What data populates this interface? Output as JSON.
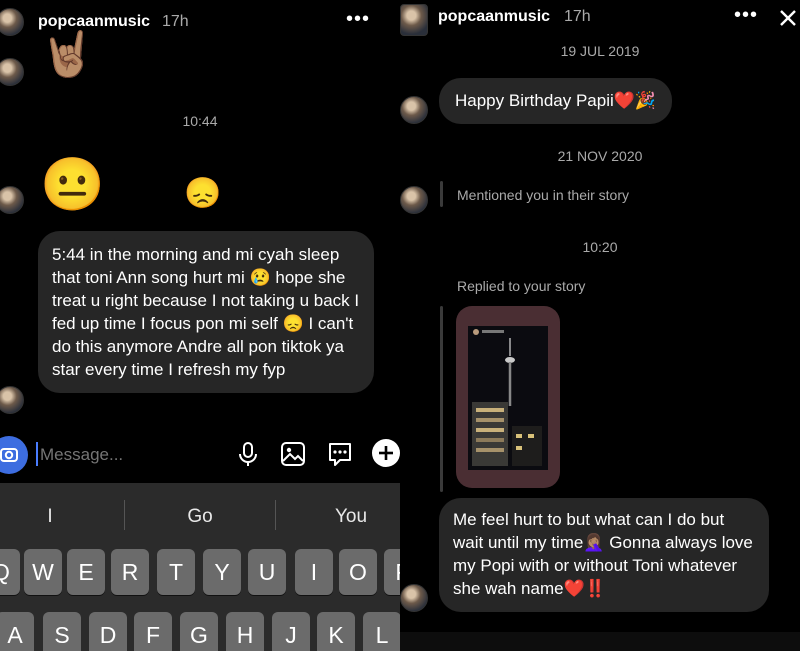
{
  "left": {
    "header": {
      "username": "popcaanmusic",
      "time": "17h"
    },
    "timestamp": "10:44",
    "message": "5:44 in the morning and mi cyah sleep that toni Ann song hurt mi 😢  hope she treat u right because I not taking u back I fed up time I focus pon mi self 😞  I can't do this anymore Andre  all pon tiktok ya star every time I refresh my fyp",
    "composer": {
      "placeholder": "Message..."
    },
    "keyboard": {
      "suggestions": [
        "I",
        "Go",
        "You"
      ],
      "row1": [
        "Q",
        "W",
        "E",
        "R",
        "T",
        "Y",
        "U",
        "I",
        "O",
        "P"
      ],
      "row2": [
        "A",
        "S",
        "D",
        "F",
        "G",
        "H",
        "J",
        "K",
        "L"
      ]
    },
    "icons": [
      "camera-icon",
      "microphone-icon",
      "gallery-icon",
      "sticker-icon",
      "plus-icon"
    ]
  },
  "right": {
    "header": {
      "username": "popcaanmusic",
      "time": "17h"
    },
    "date1": "19 JUL 2019",
    "message1": "Happy Birthday Papii❤️🎉",
    "date2": "21 NOV 2020",
    "mention_text": "Mentioned you in their story",
    "timestamp": "10:20",
    "reply_label": "Replied to your story",
    "message2": "Me feel hurt to but what can I do but wait until my time🤦🏽‍♀️ Gonna always love my Popi with or without Toni whatever she wah name❤️‼️"
  }
}
